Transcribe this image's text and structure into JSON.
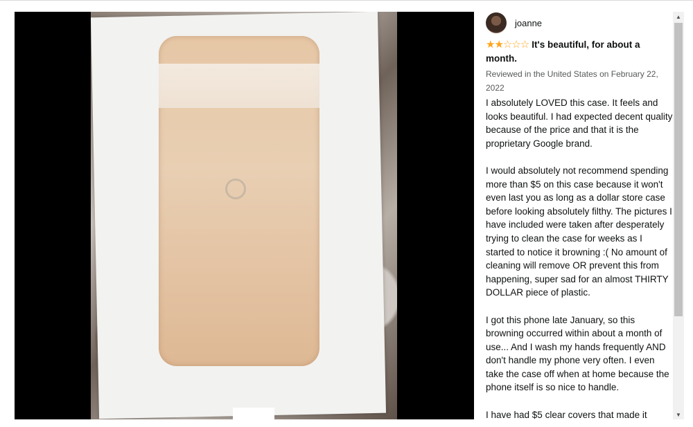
{
  "reviewer": {
    "name": "joanne",
    "avatar_icon": "user-avatar"
  },
  "rating": {
    "filled_stars": 2,
    "total_stars": 5,
    "stars_text": "★★☆☆☆"
  },
  "review": {
    "title": "It's beautiful, for about a month.",
    "meta": "Reviewed in the United States on February 22, 2022",
    "paragraphs": [
      "I absolutely LOVED this case. It feels and looks beautiful. I had expected decent quality because of the price and that it is the proprietary Google brand.",
      "I would absolutely not recommend spending more than $5 on this case because it won't even last you as long as a dollar store case before looking absolutely filthy. The pictures I have included were taken after desperately trying to clean the case for weeks as I started to notice it browning :( No amount of cleaning will remove OR prevent this from happening, super sad for an almost THIRTY DOLLAR piece of plastic.",
      "I got this phone late January, so this browning occurred within about a month of use... And I wash my hands frequently AND don't handle my phone very often. I even take the case off when at home because the phone itself is so nice to handle.",
      "I have had $5 clear covers that made it"
    ]
  },
  "scrollbar": {
    "up_icon": "▲",
    "down_icon": "▼"
  },
  "colors": {
    "star": "#ffa41c",
    "meta_text": "#565959",
    "body_text": "#0f1111"
  }
}
